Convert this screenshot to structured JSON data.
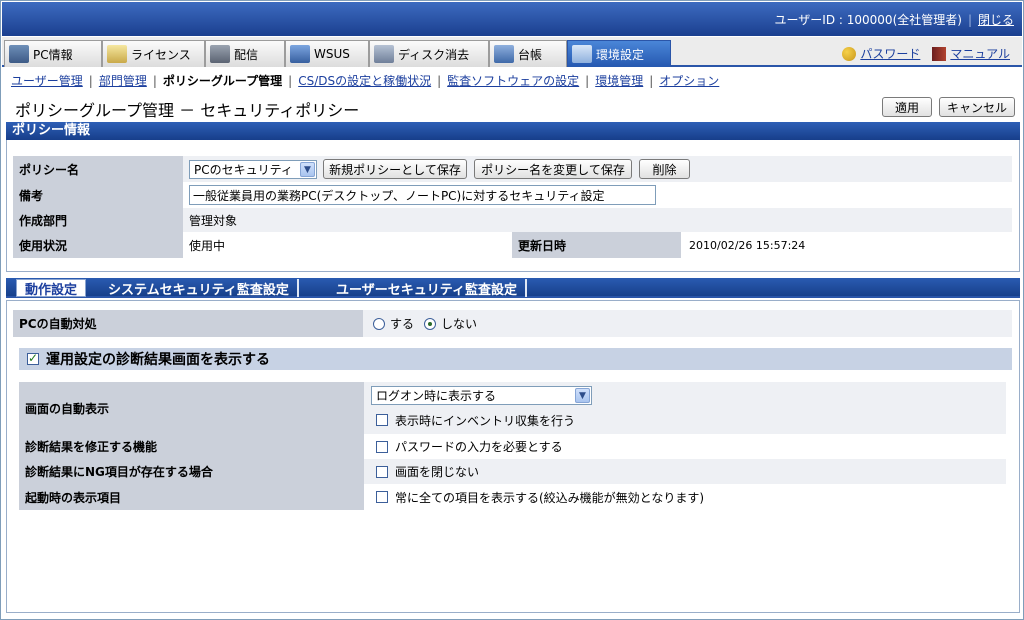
{
  "header": {
    "user_label": "ユーザーID : 100000(全社管理者)",
    "close_link": "閉じる"
  },
  "tabs": [
    {
      "label": "PC情報",
      "icon": "pc-info-icon"
    },
    {
      "label": "ライセンス",
      "icon": "license-icon"
    },
    {
      "label": "配信",
      "icon": "distribution-icon"
    },
    {
      "label": "WSUS",
      "icon": "wsus-icon"
    },
    {
      "label": "ディスク消去",
      "icon": "disk-erase-icon"
    },
    {
      "label": "台帳",
      "icon": "ledger-icon"
    },
    {
      "label": "環境設定",
      "icon": "settings-tools-icon"
    }
  ],
  "top_links": {
    "password": "パスワード",
    "manual": "マニュアル"
  },
  "subnav": {
    "user_mgmt": "ユーザー管理",
    "dept_mgmt": "部門管理",
    "policy_group": "ポリシーグループ管理",
    "csds": "CS/DSの設定と稼働状況",
    "audit_sw": "監査ソフトウェアの設定",
    "env_mgmt": "環境管理",
    "options": "オプション"
  },
  "page": {
    "title": "ポリシーグループ管理 － セキュリティポリシー",
    "apply": "適用",
    "cancel": "キャンセル"
  },
  "policy_info": {
    "section_title": "ポリシー情報",
    "name_label": "ポリシー名",
    "name_value": "PCのセキュリティ",
    "save_new": "新規ポリシーとして保存",
    "rename_save": "ポリシー名を変更して保存",
    "delete": "削除",
    "remarks_label": "備考",
    "remarks_value": "一般従業員用の業務PC(デスクトップ、ノートPC)に対するセキュリティ設定",
    "dept_label": "作成部門",
    "dept_value": "管理対象",
    "status_label": "使用状況",
    "status_value": "使用中",
    "updated_label": "更新日時",
    "updated_value": "2010/02/26 15:57:24"
  },
  "sub_tabs": [
    {
      "label": "動作設定",
      "active": true
    },
    {
      "label": "システムセキュリティ監査設定",
      "active": false
    },
    {
      "label": "ユーザーセキュリティ監査設定",
      "active": false
    }
  ],
  "auto_action": {
    "label": "PCの自動対処",
    "opt_yes": "する",
    "opt_no": "しない",
    "selected": "しない"
  },
  "diag": {
    "section_label": "運用設定の診断結果画面を表示する",
    "section_checked": true,
    "auto_display_label": "画面の自動表示",
    "auto_display_value": "ログオン時に表示する",
    "inventory_label": "表示時にインベントリ収集を行う",
    "fix_label": "診断結果を修正する機能",
    "fix_option": "パスワードの入力を必要とする",
    "ng_label": "診断結果にNG項目が存在する場合",
    "ng_option": "画面を閉じない",
    "startup_label": "起動時の表示項目",
    "startup_option": "常に全ての項目を表示する(絞込み機能が無効となります)"
  },
  "colors": {
    "header_blue": "#1b3f8f",
    "link": "#1c3f9e",
    "label_bg": "#cbd0da"
  }
}
